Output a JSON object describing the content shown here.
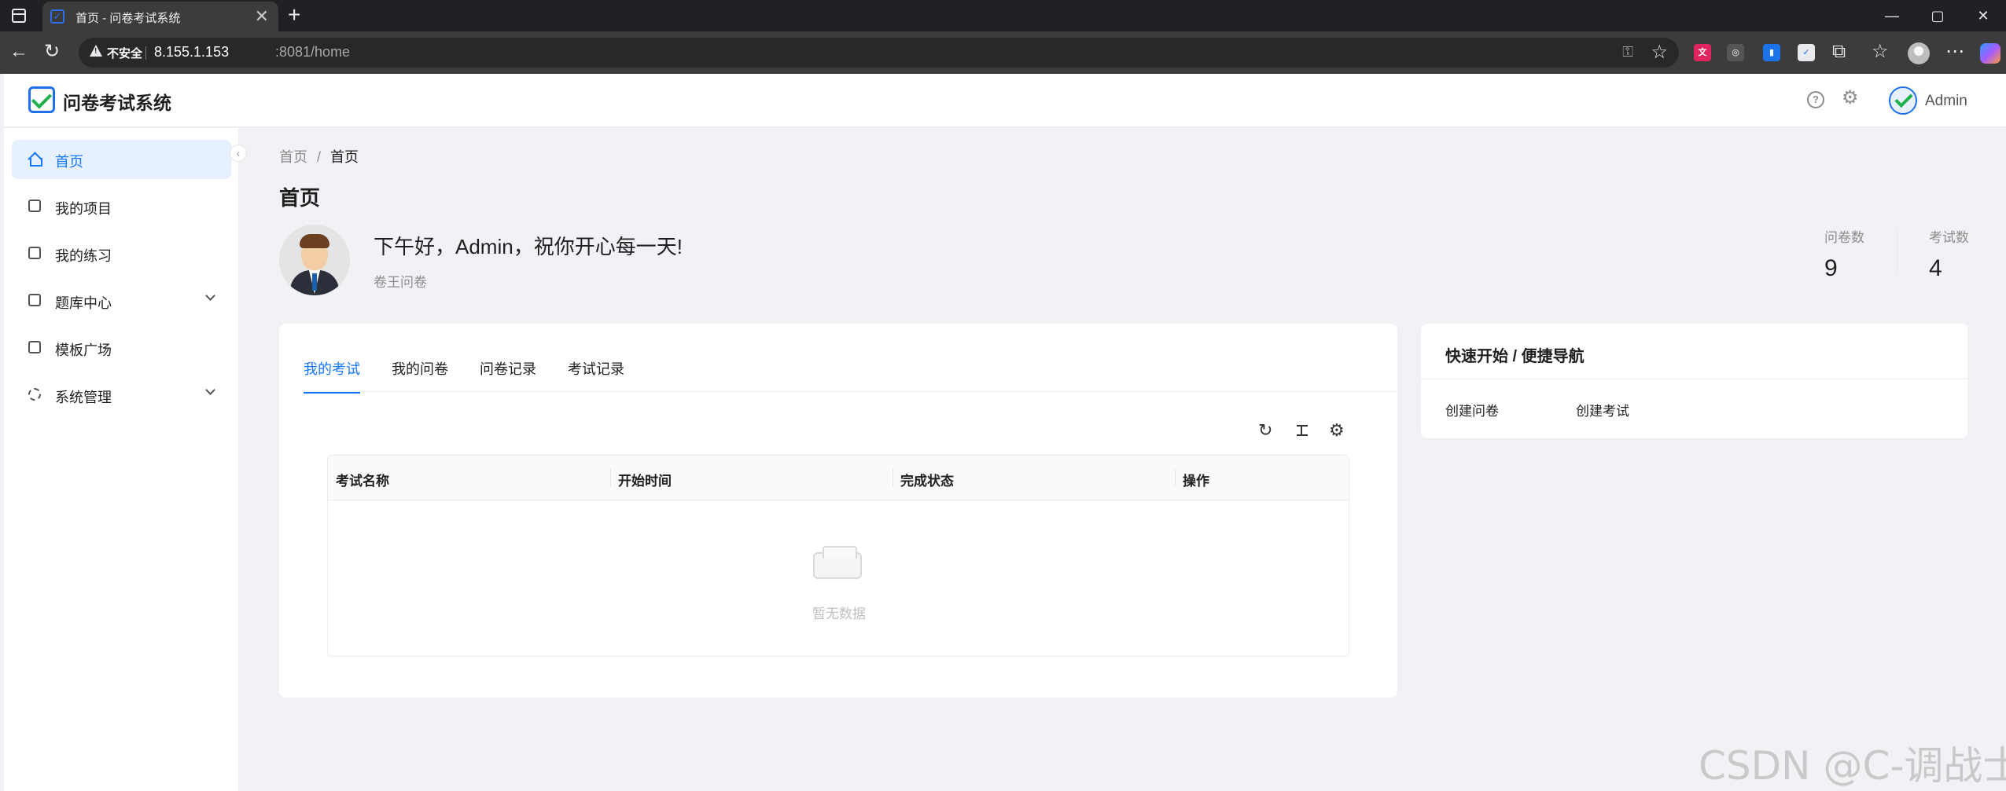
{
  "browser": {
    "tab_title": "首页 - 问卷考试系统",
    "tab_close": "✕",
    "new_tab": "+",
    "window_controls": [
      "—",
      "▢",
      "✕"
    ],
    "security_label": "不安全",
    "url_host": "8.155.1.153",
    "url_path": ":8081/home"
  },
  "header": {
    "app_title": "问卷考试系统",
    "help": "?",
    "username": "Admin"
  },
  "sidebar": {
    "items": [
      {
        "label": "首页",
        "icon": "home-icon",
        "active": true
      },
      {
        "label": "我的项目",
        "icon": "project-icon"
      },
      {
        "label": "我的练习",
        "icon": "edit-icon"
      },
      {
        "label": "题库中心",
        "icon": "book-icon",
        "expandable": true
      },
      {
        "label": "模板广场",
        "icon": "template-icon"
      },
      {
        "label": "系统管理",
        "icon": "gear-icon",
        "expandable": true
      }
    ],
    "collapse": "‹"
  },
  "content": {
    "breadcrumb": {
      "home": "首页",
      "sep": "/",
      "current": "首页"
    },
    "page_title": "首页",
    "greeting": "下午好，Admin，祝你开心每一天!",
    "greeting_sub": "卷王问卷",
    "stats": [
      {
        "label": "问卷数",
        "value": "9"
      },
      {
        "label": "考试数",
        "value": "4"
      }
    ],
    "tabs": [
      "我的考试",
      "我的问卷",
      "问卷记录",
      "考试记录"
    ],
    "table": {
      "tools": {
        "refresh": "↻",
        "settings": "⚙"
      },
      "columns": [
        "考试名称",
        "开始时间",
        "完成状态",
        "操作"
      ],
      "empty_text": "暂无数据"
    },
    "quick_nav": {
      "title": "快速开始 / 便捷导航",
      "links": [
        "创建问卷",
        "创建考试"
      ]
    }
  },
  "watermark": "CSDN @C-调战士"
}
